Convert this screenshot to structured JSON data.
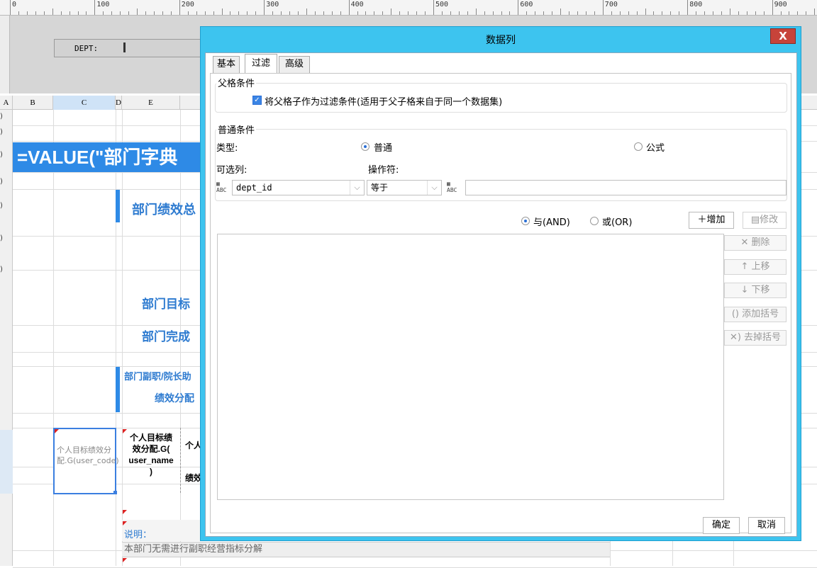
{
  "ruler": {
    "labels": [
      "0",
      "100",
      "200",
      "300",
      "400",
      "500",
      "600",
      "700",
      "800",
      "900"
    ]
  },
  "top": {
    "dept_label": "DEPT:"
  },
  "sheet": {
    "columns": [
      "A",
      "B",
      "C",
      "D",
      "E"
    ],
    "rows": [
      ")",
      ")",
      ")",
      ")",
      ")",
      ")",
      ")",
      ")"
    ],
    "formula": "=VALUE(\"部门字典",
    "dept_summary": "部门绩效总",
    "target": "部门目标",
    "complete": "部门完成",
    "vice_header": "部门副职/院长助",
    "perf_alloc": "绩效分配",
    "selected_cell": "个人目标绩效分配.G(user_code)",
    "cellE": [
      "个人目标绩",
      "效分配.G(",
      "user_name",
      ")"
    ],
    "cellF_top": "个人",
    "cellF_bottom": "绩效",
    "note_label": "说明：",
    "note_text": "本部门无需进行副职经营指标分解"
  },
  "dialog": {
    "title": "数据列",
    "close": "X",
    "tabs": [
      "基本",
      "过滤",
      "高级"
    ],
    "active_tab": "过滤",
    "parent_group": "父格条件",
    "parent_checkbox": "将父格子作为过滤条件(适用于父子格来自于同一个数据集)",
    "normal_group": "普通条件",
    "type_label": "类型:",
    "type_normal": "普通",
    "type_formula": "公式",
    "column_label": "可选列:",
    "operator_label": "操作符:",
    "column_value": "dept_id",
    "operator_value": "等于",
    "value_text": "",
    "and_label": "与(AND)",
    "or_label": "或(OR)",
    "add_btn": "增加",
    "modify_btn": "修改",
    "side_buttons": [
      "删除",
      "上移",
      "下移",
      "添加括号",
      "去掉括号"
    ],
    "ok": "确定",
    "cancel": "取消"
  }
}
